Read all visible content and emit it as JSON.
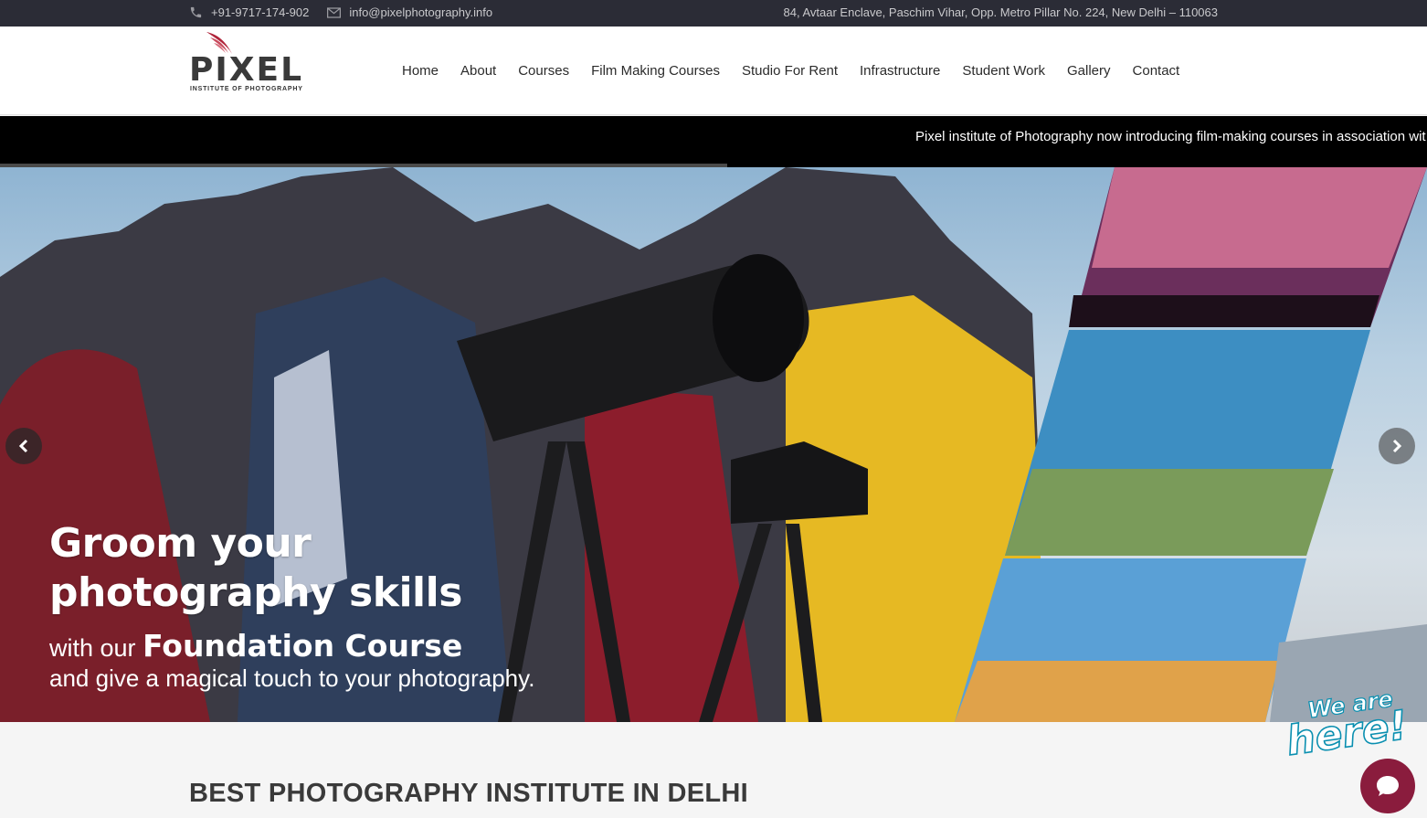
{
  "topbar": {
    "phone": "+91-9717-174-902",
    "email": "info@pixelphotography.info",
    "address": "84, Avtaar Enclave, Paschim Vihar, Opp. Metro Pillar No. 224, New Delhi – 110063"
  },
  "logo": {
    "name": "PIXEL",
    "tagline": "INSTITUTE OF PHOTOGRAPHY"
  },
  "nav": {
    "items": [
      "Home",
      "About",
      "Courses",
      "Film Making Courses",
      "Studio For Rent",
      "Infrastructure",
      "Student Work",
      "Gallery",
      "Contact"
    ]
  },
  "ticker": {
    "message": "Pixel institute of Photography now introducing film-making courses in association wit"
  },
  "hero": {
    "headline_1": "Groom your",
    "headline_2": "photography skills",
    "sub_prefix": "with our",
    "sub_course": "Foundation Course",
    "sub_line": "and give a magical touch to your photography."
  },
  "section": {
    "title": "BEST PHOTOGRAPHY INSTITUTE IN DELHI"
  },
  "chat": {
    "badge_line1": "We are",
    "badge_line2": "here!"
  },
  "colors": {
    "topbar_bg": "#2b2c36",
    "ticker_bg": "#000000",
    "chat_button": "#8a1c3d",
    "logo_accent": "#b0243a"
  },
  "icons": {
    "phone": "phone-icon",
    "email": "envelope-icon",
    "prev": "chevron-left-icon",
    "next": "chevron-right-icon",
    "chat": "chat-bubble-icon"
  }
}
